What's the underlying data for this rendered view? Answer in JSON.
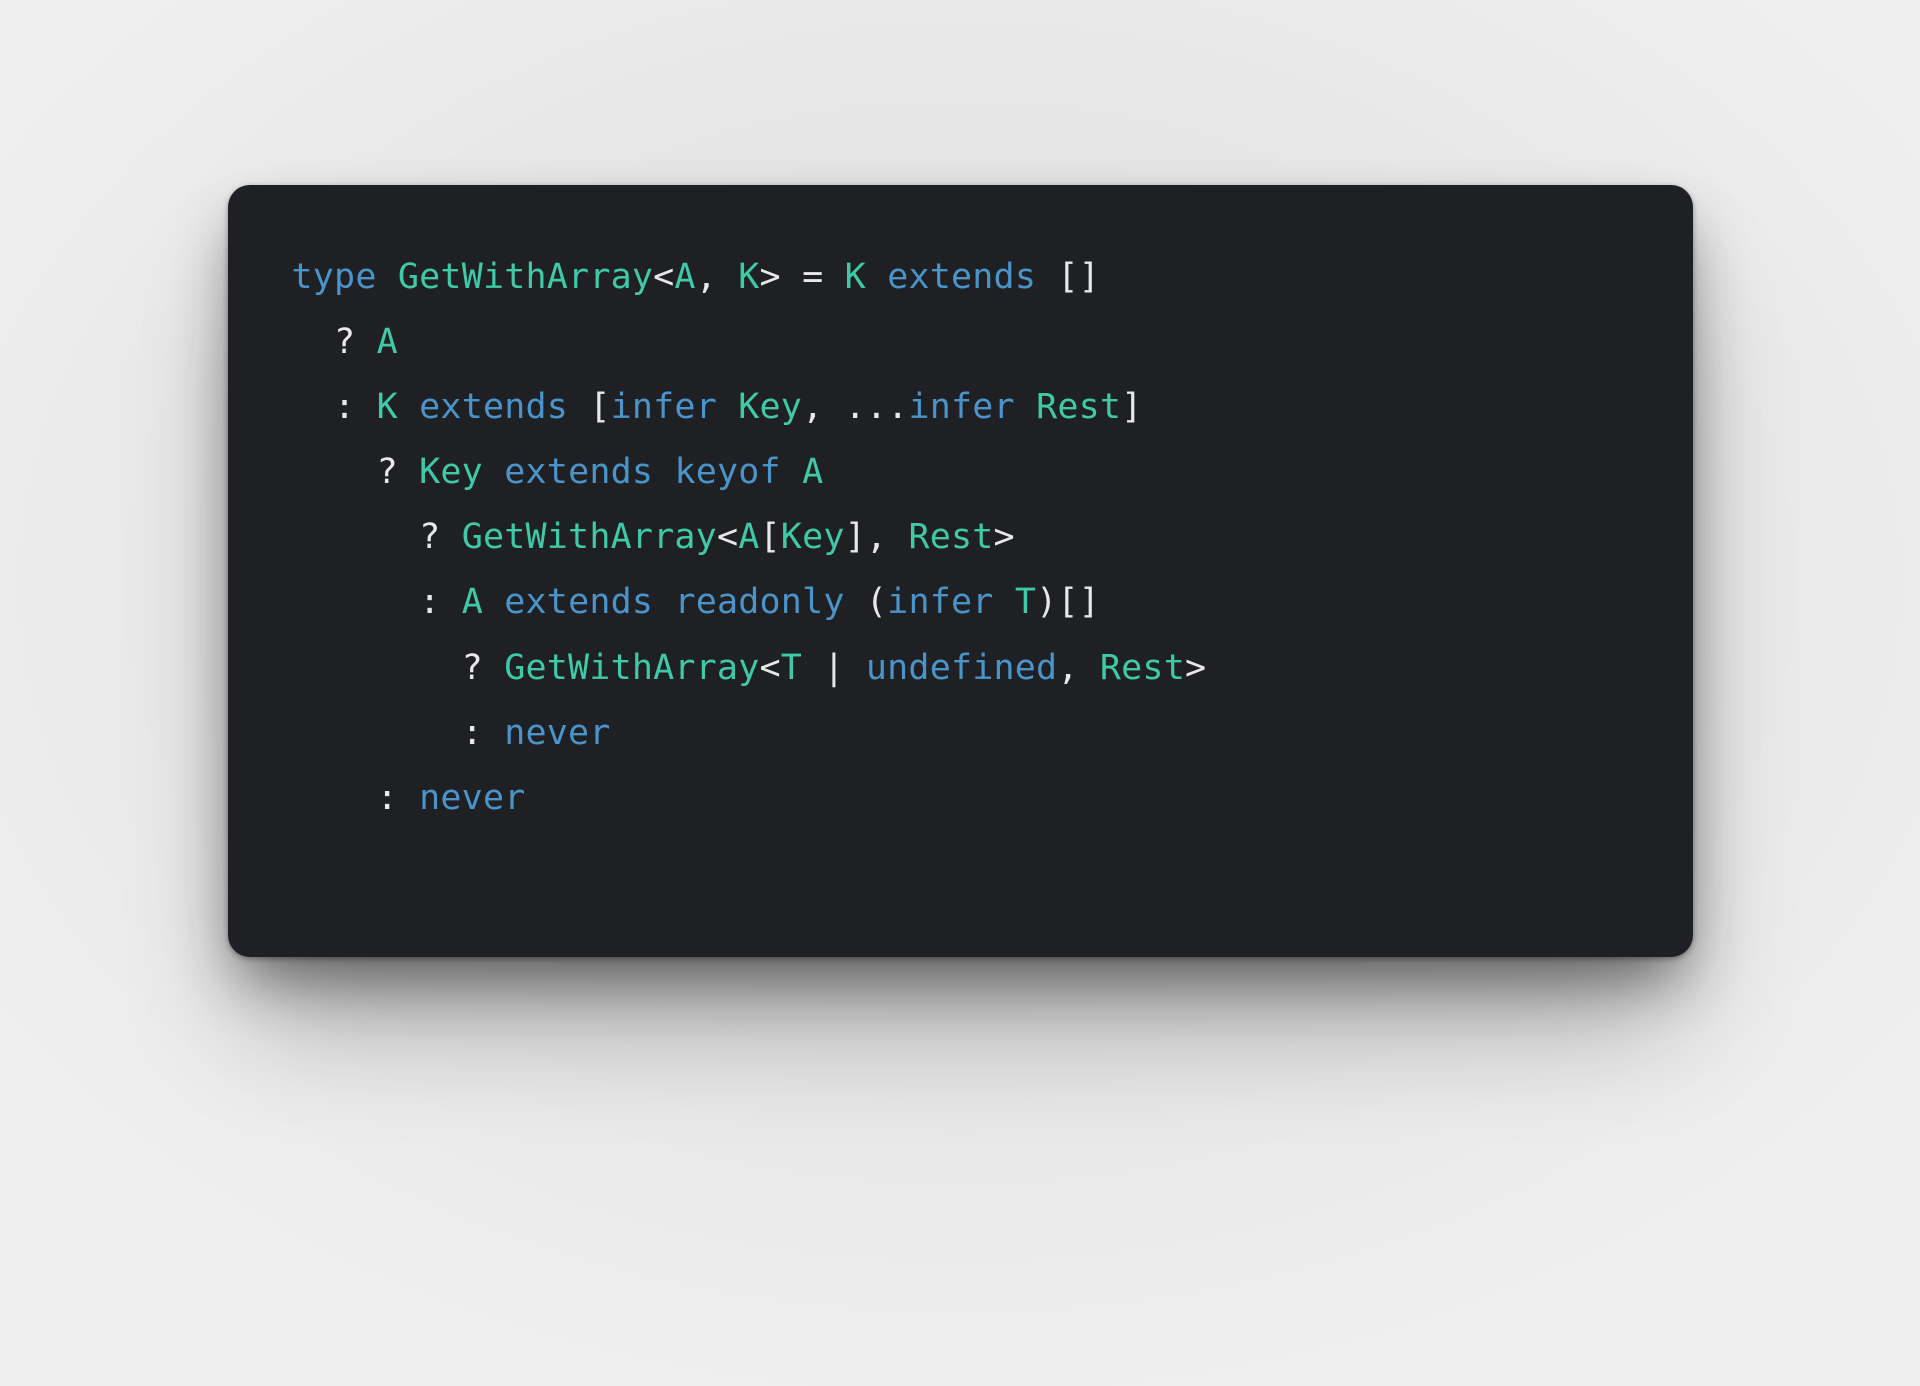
{
  "colors": {
    "page_bg": "#efefef",
    "card_bg": "#1f2023",
    "code_fg": "#e8e8e8",
    "keyword": "#4a94c9",
    "typename": "#3fc9a7",
    "punct": "#e8e8e8"
  },
  "code": {
    "language": "typescript",
    "plain": "type GetWithArray<A, K> = K extends []\n  ? A\n  : K extends [infer Key, ...infer Rest]\n    ? Key extends keyof A\n      ? GetWithArray<A[Key], Rest>\n      : A extends readonly (infer T)[]\n        ? GetWithArray<T | undefined, Rest>\n        : never\n    : never",
    "lines": [
      [
        {
          "t": "type",
          "c": "kw"
        },
        {
          "t": " ",
          "c": "punc"
        },
        {
          "t": "GetWithArray",
          "c": "type"
        },
        {
          "t": "<",
          "c": "punc"
        },
        {
          "t": "A",
          "c": "type"
        },
        {
          "t": ", ",
          "c": "punc"
        },
        {
          "t": "K",
          "c": "type"
        },
        {
          "t": "> = ",
          "c": "punc"
        },
        {
          "t": "K",
          "c": "type"
        },
        {
          "t": " ",
          "c": "punc"
        },
        {
          "t": "extends",
          "c": "kw"
        },
        {
          "t": " []",
          "c": "punc"
        }
      ],
      [
        {
          "t": "  ? ",
          "c": "punc"
        },
        {
          "t": "A",
          "c": "type"
        }
      ],
      [
        {
          "t": "  : ",
          "c": "punc"
        },
        {
          "t": "K",
          "c": "type"
        },
        {
          "t": " ",
          "c": "punc"
        },
        {
          "t": "extends",
          "c": "kw"
        },
        {
          "t": " [",
          "c": "punc"
        },
        {
          "t": "infer",
          "c": "kw"
        },
        {
          "t": " ",
          "c": "punc"
        },
        {
          "t": "Key",
          "c": "type"
        },
        {
          "t": ", ...",
          "c": "punc"
        },
        {
          "t": "infer",
          "c": "kw"
        },
        {
          "t": " ",
          "c": "punc"
        },
        {
          "t": "Rest",
          "c": "type"
        },
        {
          "t": "]",
          "c": "punc"
        }
      ],
      [
        {
          "t": "    ? ",
          "c": "punc"
        },
        {
          "t": "Key",
          "c": "type"
        },
        {
          "t": " ",
          "c": "punc"
        },
        {
          "t": "extends",
          "c": "kw"
        },
        {
          "t": " ",
          "c": "punc"
        },
        {
          "t": "keyof",
          "c": "kw"
        },
        {
          "t": " ",
          "c": "punc"
        },
        {
          "t": "A",
          "c": "type"
        }
      ],
      [
        {
          "t": "      ? ",
          "c": "punc"
        },
        {
          "t": "GetWithArray",
          "c": "type"
        },
        {
          "t": "<",
          "c": "punc"
        },
        {
          "t": "A",
          "c": "type"
        },
        {
          "t": "[",
          "c": "punc"
        },
        {
          "t": "Key",
          "c": "type"
        },
        {
          "t": "], ",
          "c": "punc"
        },
        {
          "t": "Rest",
          "c": "type"
        },
        {
          "t": ">",
          "c": "punc"
        }
      ],
      [
        {
          "t": "      : ",
          "c": "punc"
        },
        {
          "t": "A",
          "c": "type"
        },
        {
          "t": " ",
          "c": "punc"
        },
        {
          "t": "extends",
          "c": "kw"
        },
        {
          "t": " ",
          "c": "punc"
        },
        {
          "t": "readonly",
          "c": "kw"
        },
        {
          "t": " (",
          "c": "punc"
        },
        {
          "t": "infer",
          "c": "kw"
        },
        {
          "t": " ",
          "c": "punc"
        },
        {
          "t": "T",
          "c": "type"
        },
        {
          "t": ")[]",
          "c": "punc"
        }
      ],
      [
        {
          "t": "        ? ",
          "c": "punc"
        },
        {
          "t": "GetWithArray",
          "c": "type"
        },
        {
          "t": "<",
          "c": "punc"
        },
        {
          "t": "T",
          "c": "type"
        },
        {
          "t": " | ",
          "c": "punc"
        },
        {
          "t": "undefined",
          "c": "kw"
        },
        {
          "t": ", ",
          "c": "punc"
        },
        {
          "t": "Rest",
          "c": "type"
        },
        {
          "t": ">",
          "c": "punc"
        }
      ],
      [
        {
          "t": "        : ",
          "c": "punc"
        },
        {
          "t": "never",
          "c": "kw"
        }
      ],
      [
        {
          "t": "    : ",
          "c": "punc"
        },
        {
          "t": "never",
          "c": "kw"
        }
      ]
    ]
  }
}
